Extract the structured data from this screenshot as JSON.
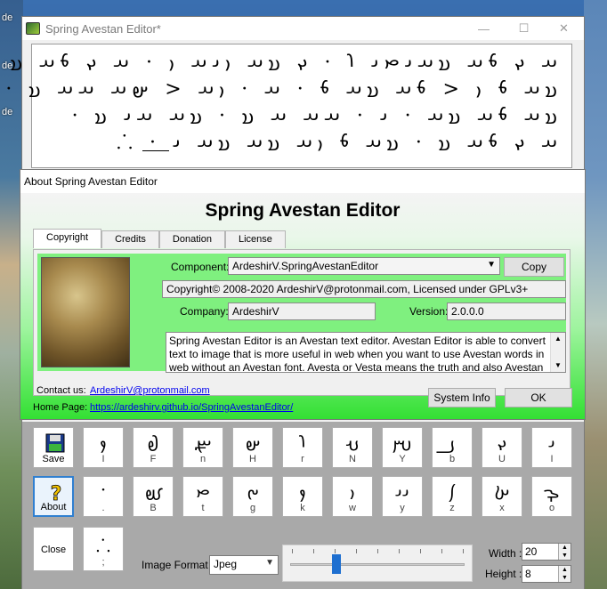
{
  "desktop": {
    "labels": [
      "de",
      "de",
      "de"
    ]
  },
  "main_window": {
    "title": "Spring Avestan Editor*",
    "controls": {
      "minimize": "—",
      "maximize": "☐",
      "close": "✕"
    },
    "canvas_lines": [
      "· 𐬀 𐬏 𐬨𐬀 𐬯𐬀𐬌𐬙𐬌 𐬭 · 𐬏 𐬯𐬀 𐬎𐬌𐬀 𐬎 · 𐬀 𐬏 𐬨𐬀 𐬯",
      "· 𐬯𐬀 𐬨 𐬎 < 𐬨𐬀 𐬯𐬀 𐬨 · 𐬀 · 𐬎𐬀 < 𐬵𐬀 𐬀𐬀 𐬯",
      "· 𐬯𐬀 𐬨𐬀 𐬯𐬀 · 𐬌 · 𐬀𐬀 𐬀 𐬯 · 𐬯𐬀 𐬀𐬌 𐬯",
      "⸫ · 𐬀 𐬏 𐬨𐬀 𐬯 · 𐬯𐬀 𐬨 𐬎𐬀 𐬯𐬀 𐬯𐬀 𐬌"
    ]
  },
  "keypad": {
    "tools": [
      {
        "name": "save",
        "label": "Save"
      },
      {
        "name": "about",
        "label": "About"
      },
      {
        "name": "close",
        "label": "Close"
      }
    ],
    "row1": [
      {
        "glyph": "𐬐",
        "label": "I"
      },
      {
        "glyph": "𐬟",
        "label": "F"
      },
      {
        "glyph": "𐬧",
        "label": "n"
      },
      {
        "glyph": "𐬵",
        "label": "H"
      },
      {
        "glyph": "𐬭",
        "label": "r"
      },
      {
        "glyph": "𐬣",
        "label": "N"
      },
      {
        "glyph": "𐬫",
        "label": "Y"
      },
      {
        "glyph": "𐬠",
        "label": "b"
      },
      {
        "glyph": "𐬏",
        "label": "U"
      },
      {
        "glyph": "𐬌",
        "label": "I"
      }
    ],
    "row2": [
      {
        "glyph": "·",
        "label": "."
      },
      {
        "glyph": "𐬡",
        "label": "B"
      },
      {
        "glyph": "𐬙",
        "label": "t"
      },
      {
        "glyph": "𐬔",
        "label": "g"
      },
      {
        "glyph": "𐬐",
        "label": "k"
      },
      {
        "glyph": "𐬎",
        "label": "w"
      },
      {
        "glyph": "𐬌𐬌",
        "label": "y"
      },
      {
        "glyph": "𐬰",
        "label": "z"
      },
      {
        "glyph": "𐬑",
        "label": "x"
      },
      {
        "glyph": "𐬋",
        "label": "o"
      }
    ],
    "row3_key": {
      "glyph": "⸫",
      "label": ";"
    },
    "image_format_label": "Image Format :",
    "image_format_value": "Jpeg",
    "slider_fraction": 0.25,
    "width_label": "Width :",
    "width_value": "20",
    "height_label": "Height :",
    "height_value": "8"
  },
  "about": {
    "title": "About Spring Avestan Editor",
    "heading": "Spring Avestan Editor",
    "tabs": [
      "Copyright",
      "Credits",
      "Donation",
      "License"
    ],
    "component_label": "Component:",
    "component_value": "ArdeshirV.SpringAvestanEditor",
    "copy_button": "Copy",
    "copyright_text": "Copyright© 2008-2020 ArdeshirV@protonmail.com, Licensed under GPLv3+",
    "company_label": "Company:",
    "company_value": "ArdeshirV",
    "version_label": "Version:",
    "version_value": "2.0.0.0",
    "description": "Spring Avestan Editor is an Avestan text editor. Avestan Editor is able to convert text to image that is more useful in web when you want to use Avestan words in web without an Avestan font. Avesta or Vesta means the truth and also Avestan",
    "contact_label": "Contact us:",
    "contact_value": "ArdeshirV@protonmail.com",
    "homepage_label": "Home Page:",
    "homepage_value": "https://ardeshirv.github.io/SpringAvestanEditor/",
    "system_info_button": "System Info",
    "ok_button": "OK"
  }
}
